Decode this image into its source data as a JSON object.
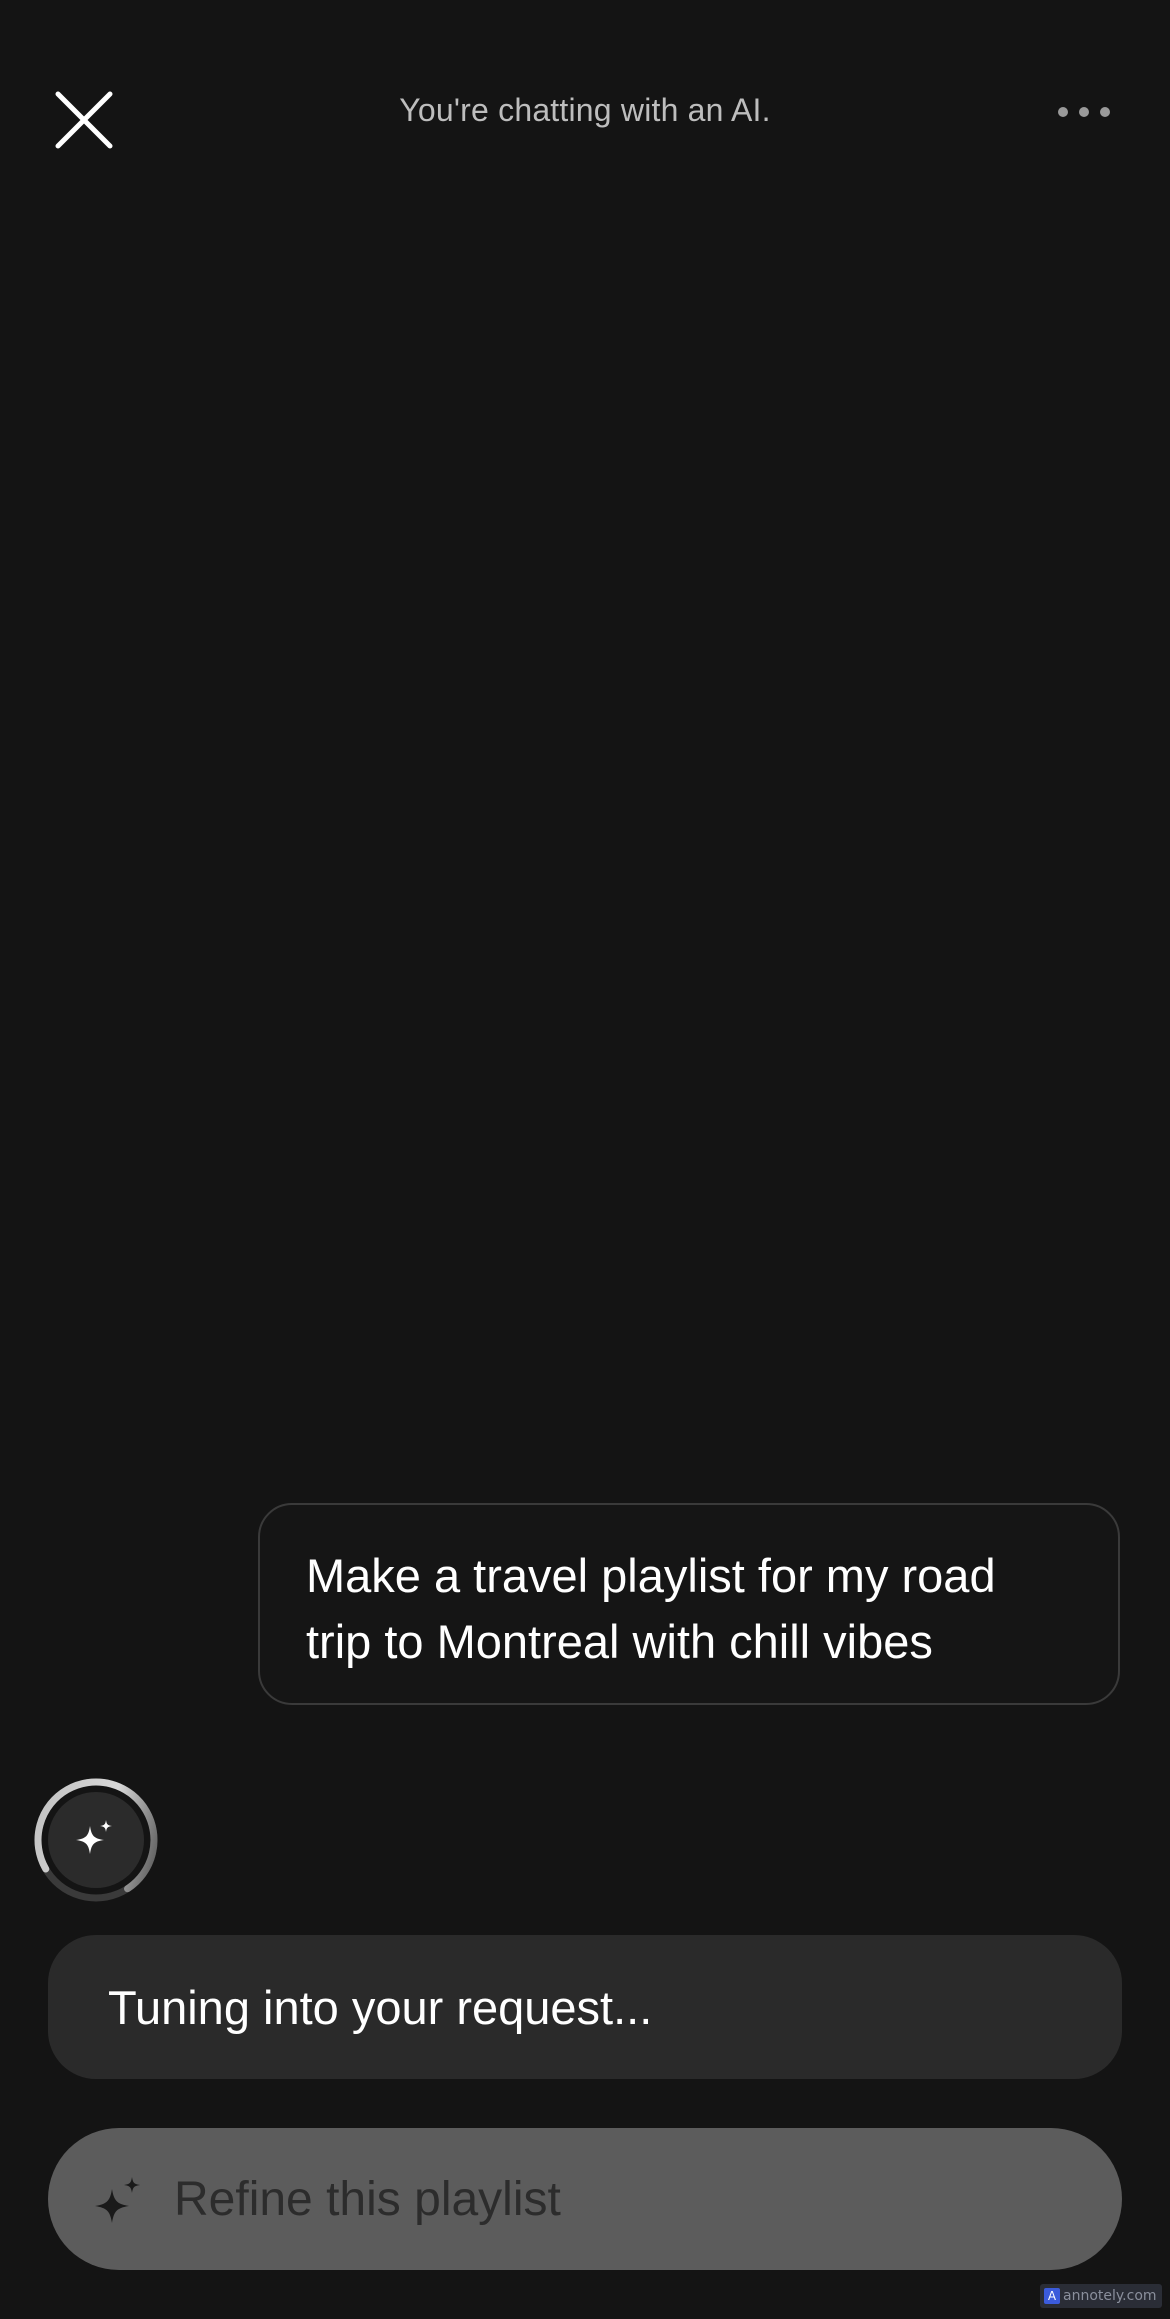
{
  "header": {
    "title": "You're chatting with an AI.",
    "close_icon": "close-icon",
    "more_icon": "more-horizontal-icon"
  },
  "messages": {
    "user": {
      "text": "Make a travel playlist for my road trip to Montreal with chill vibes"
    },
    "assistant": {
      "avatar_icon": "sparkle-icon",
      "status_text": "Tuning into your request..."
    }
  },
  "composer": {
    "placeholder": "Refine this playlist",
    "icon": "sparkle-icon"
  },
  "watermark": {
    "badge": "A",
    "text": "annotely.com"
  },
  "colors": {
    "background": "#141414",
    "status_bubble": "#2a2a2a",
    "input_pill": "#5c5c5c",
    "header_text": "#bdbdbd"
  }
}
